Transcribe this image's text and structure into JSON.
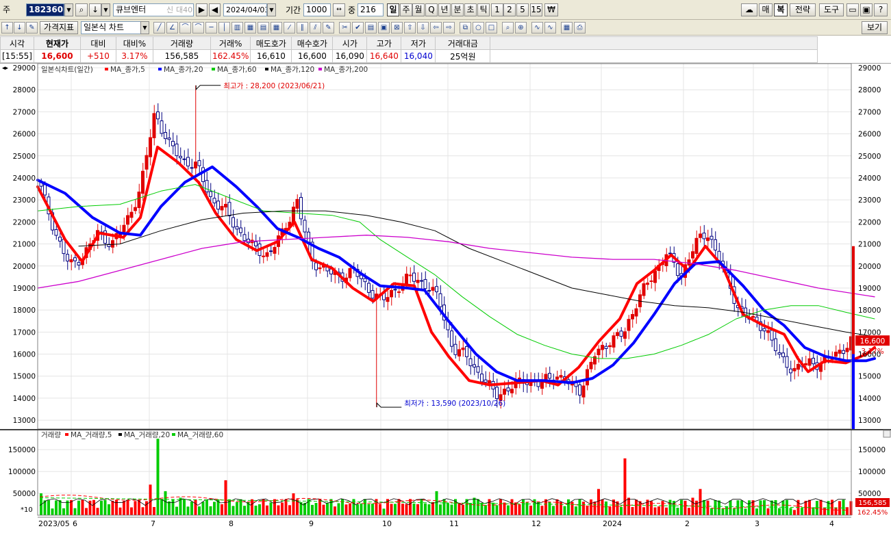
{
  "toolbar": {
    "code_label": "주",
    "code": "182360",
    "name": "큐브엔터",
    "badge1": "신",
    "badge2": "대40",
    "date": "2024/04/03",
    "period_label": "기간",
    "period": "1000",
    "count_label": "중",
    "count": "216",
    "periods": [
      "일",
      "주",
      "월",
      "Q",
      "년",
      "분",
      "초",
      "틱",
      "1",
      "2",
      "5",
      "15",
      "₩"
    ],
    "active_period": "일",
    "right_buttons": [
      "매",
      "복",
      "전략",
      "도구"
    ]
  },
  "toolbar2": {
    "menu1": "가격지표",
    "chart_type": "일본식 차트",
    "right_button": "보기"
  },
  "quote": {
    "headers": [
      "시각",
      "현재가",
      "대비",
      "대비%",
      "거래량",
      "거래%",
      "매도호가",
      "매수호가",
      "시가",
      "고가",
      "저가",
      "거래대금"
    ],
    "values": [
      "[15:55]",
      "16,600",
      "+510",
      "3.17%",
      "156,585",
      "162.45%",
      "16,610",
      "16,600",
      "16,090",
      "16,640",
      "16,040",
      "25억원"
    ]
  },
  "colors": {
    "up": "#e00000",
    "down": "#000080",
    "ma5": "#ff0000",
    "ma20": "#0000ff",
    "ma60": "#00cc00",
    "ma120": "#000000",
    "ma200": "#cc00cc"
  },
  "price_chart": {
    "legend_title": "일본식차트(일간)",
    "legend": [
      "MA_종가,5",
      "MA_종가,20",
      "MA_종가,60",
      "MA_종가,120",
      "MA_종가,200"
    ],
    "y_ticks": [
      "29000",
      "28000",
      "27000",
      "26000",
      "25000",
      "24000",
      "23000",
      "22000",
      "21000",
      "20000",
      "19000",
      "18000",
      "17000",
      "16000",
      "15000",
      "14000",
      "13000"
    ],
    "max_label": "최고가 : 28,200 (2023/06/21)",
    "min_label": "최저가 : 13,590 (2023/10/26)",
    "current_price": "16,600",
    "current_pct": "3.17%"
  },
  "volume_chart": {
    "legend_title": "거래량",
    "legend": [
      "MA_거래량,5",
      "MA_거래량,20",
      "MA_거래량,60"
    ],
    "y_ticks": [
      "150000",
      "100000",
      "50000"
    ],
    "unit_label": "*10",
    "current_volume": "156,585",
    "current_pct": "162.45%"
  },
  "x_axis": {
    "labels": [
      "2023/05",
      "6",
      "7",
      "8",
      "9",
      "10",
      "11",
      "12",
      "2024",
      "2",
      "3",
      "4"
    ]
  },
  "chart_data": {
    "type": "candlestick",
    "title": "일본식차트(일간)",
    "ylim": [
      12600,
      29000
    ],
    "x": [
      "2023/05",
      "6",
      "7",
      "8",
      "9",
      "10",
      "11",
      "12",
      "2024",
      "2",
      "3",
      "4"
    ],
    "close_anchor_points": [
      [
        "2023/05",
        23500
      ],
      [
        "2023/05",
        21500
      ],
      [
        "2023/05",
        20000
      ],
      [
        "6",
        20500
      ],
      [
        "6",
        21500
      ],
      [
        "6",
        21000
      ],
      [
        "6",
        22000
      ],
      [
        "6",
        23500
      ],
      [
        "6",
        27000
      ],
      [
        "6",
        25500
      ],
      [
        "7",
        24800
      ],
      [
        "7",
        24500
      ],
      [
        "7",
        23000
      ],
      [
        "7",
        22500
      ],
      [
        "7",
        21500
      ],
      [
        "7",
        20800
      ],
      [
        "8",
        20500
      ],
      [
        "8",
        21500
      ],
      [
        "8",
        23000
      ],
      [
        "8",
        20300
      ],
      [
        "8",
        19800
      ],
      [
        "8",
        19500
      ],
      [
        "9",
        19800
      ],
      [
        "9",
        19000
      ],
      [
        "9",
        18400
      ],
      [
        "9",
        19000
      ],
      [
        "9",
        19500
      ],
      [
        "10",
        19200
      ],
      [
        "10",
        18500
      ],
      [
        "10",
        16200
      ],
      [
        "10",
        15900
      ],
      [
        "10",
        14900
      ],
      [
        "10",
        14200
      ],
      [
        "11",
        14400
      ],
      [
        "11",
        14900
      ],
      [
        "11",
        14600
      ],
      [
        "11",
        15100
      ],
      [
        "11",
        14700
      ],
      [
        "12",
        14400
      ],
      [
        "12",
        16000
      ],
      [
        "12",
        16600
      ],
      [
        "12",
        16900
      ],
      [
        "12",
        18500
      ],
      [
        "2024",
        19500
      ],
      [
        "2024",
        20600
      ],
      [
        "2024",
        19500
      ],
      [
        "2024",
        21000
      ],
      [
        "2024",
        21500
      ],
      [
        "2",
        19800
      ],
      [
        "2",
        18200
      ],
      [
        "2",
        17500
      ],
      [
        "2",
        17200
      ],
      [
        "3",
        15800
      ],
      [
        "3",
        15300
      ],
      [
        "3",
        15600
      ],
      [
        "3",
        15600
      ],
      [
        "4",
        16000
      ],
      [
        "4",
        16600
      ]
    ],
    "series": [
      {
        "name": "MA_종가,5",
        "points": [
          [
            0,
            23600
          ],
          [
            40,
            21200
          ],
          [
            65,
            20200
          ],
          [
            90,
            21500
          ],
          [
            125,
            21300
          ],
          [
            150,
            22200
          ],
          [
            175,
            25400
          ],
          [
            205,
            24700
          ],
          [
            235,
            23800
          ],
          [
            260,
            22400
          ],
          [
            290,
            21200
          ],
          [
            320,
            20700
          ],
          [
            350,
            21100
          ],
          [
            375,
            22000
          ],
          [
            400,
            20300
          ],
          [
            430,
            19900
          ],
          [
            460,
            19000
          ],
          [
            490,
            18400
          ],
          [
            520,
            19200
          ],
          [
            550,
            19100
          ],
          [
            575,
            17000
          ],
          [
            600,
            15900
          ],
          [
            630,
            14800
          ],
          [
            660,
            14600
          ],
          [
            700,
            14700
          ],
          [
            735,
            14800
          ],
          [
            760,
            14600
          ],
          [
            790,
            15400
          ],
          [
            820,
            16600
          ],
          [
            850,
            17600
          ],
          [
            875,
            19200
          ],
          [
            900,
            19800
          ],
          [
            925,
            20500
          ],
          [
            950,
            19800
          ],
          [
            975,
            20900
          ],
          [
            1000,
            20000
          ],
          [
            1030,
            17800
          ],
          [
            1060,
            17300
          ],
          [
            1090,
            16900
          ],
          [
            1110,
            15800
          ],
          [
            1125,
            15200
          ],
          [
            1150,
            15700
          ],
          [
            1180,
            15600
          ],
          [
            1210,
            16000
          ],
          [
            1222,
            16300
          ]
        ]
      },
      {
        "name": "MA_종가,20",
        "points": [
          [
            0,
            23900
          ],
          [
            40,
            23300
          ],
          [
            80,
            22200
          ],
          [
            120,
            21500
          ],
          [
            150,
            21400
          ],
          [
            180,
            22700
          ],
          [
            215,
            23800
          ],
          [
            255,
            24500
          ],
          [
            290,
            23600
          ],
          [
            320,
            22700
          ],
          [
            350,
            21700
          ],
          [
            380,
            21300
          ],
          [
            410,
            20800
          ],
          [
            440,
            20400
          ],
          [
            470,
            19700
          ],
          [
            500,
            19100
          ],
          [
            540,
            19000
          ],
          [
            565,
            18900
          ],
          [
            600,
            17500
          ],
          [
            640,
            16000
          ],
          [
            670,
            15200
          ],
          [
            700,
            14800
          ],
          [
            740,
            14800
          ],
          [
            780,
            14700
          ],
          [
            810,
            14900
          ],
          [
            840,
            15500
          ],
          [
            870,
            16500
          ],
          [
            900,
            17800
          ],
          [
            930,
            19200
          ],
          [
            960,
            20100
          ],
          [
            995,
            20200
          ],
          [
            1030,
            19100
          ],
          [
            1060,
            18000
          ],
          [
            1090,
            17300
          ],
          [
            1120,
            16300
          ],
          [
            1150,
            15900
          ],
          [
            1180,
            15700
          ],
          [
            1210,
            15700
          ],
          [
            1222,
            15800
          ]
        ]
      },
      {
        "name": "MA_종가,60",
        "points": [
          [
            0,
            22500
          ],
          [
            60,
            22700
          ],
          [
            120,
            22800
          ],
          [
            180,
            23400
          ],
          [
            230,
            23700
          ],
          [
            280,
            23100
          ],
          [
            330,
            22500
          ],
          [
            380,
            22400
          ],
          [
            430,
            22300
          ],
          [
            470,
            22000
          ],
          [
            500,
            21200
          ],
          [
            540,
            20400
          ],
          [
            580,
            19600
          ],
          [
            620,
            18600
          ],
          [
            660,
            17700
          ],
          [
            700,
            16900
          ],
          [
            740,
            16400
          ],
          [
            780,
            16000
          ],
          [
            820,
            15800
          ],
          [
            860,
            15800
          ],
          [
            900,
            16000
          ],
          [
            940,
            16400
          ],
          [
            980,
            16900
          ],
          [
            1020,
            17600
          ],
          [
            1060,
            18000
          ],
          [
            1100,
            18200
          ],
          [
            1140,
            18200
          ],
          [
            1180,
            17900
          ],
          [
            1222,
            17600
          ]
        ]
      },
      {
        "name": "MA_종가,120",
        "points": [
          [
            60,
            20900
          ],
          [
            120,
            21000
          ],
          [
            180,
            21600
          ],
          [
            240,
            22100
          ],
          [
            300,
            22400
          ],
          [
            360,
            22500
          ],
          [
            420,
            22500
          ],
          [
            480,
            22300
          ],
          [
            530,
            22000
          ],
          [
            580,
            21600
          ],
          [
            630,
            20800
          ],
          [
            680,
            20200
          ],
          [
            730,
            19600
          ],
          [
            780,
            19000
          ],
          [
            830,
            18700
          ],
          [
            880,
            18400
          ],
          [
            930,
            18200
          ],
          [
            980,
            18100
          ],
          [
            1030,
            17900
          ],
          [
            1080,
            17600
          ],
          [
            1130,
            17300
          ],
          [
            1180,
            17000
          ],
          [
            1222,
            16800
          ]
        ]
      },
      {
        "name": "MA_종가,200",
        "points": [
          [
            0,
            19000
          ],
          [
            60,
            19300
          ],
          [
            120,
            19800
          ],
          [
            180,
            20300
          ],
          [
            240,
            20800
          ],
          [
            300,
            21100
          ],
          [
            360,
            21200
          ],
          [
            420,
            21300
          ],
          [
            480,
            21400
          ],
          [
            540,
            21300
          ],
          [
            600,
            21100
          ],
          [
            660,
            20800
          ],
          [
            720,
            20600
          ],
          [
            780,
            20400
          ],
          [
            840,
            20300
          ],
          [
            900,
            20300
          ],
          [
            960,
            20100
          ],
          [
            1020,
            19800
          ],
          [
            1080,
            19400
          ],
          [
            1140,
            19000
          ],
          [
            1222,
            18600
          ]
        ]
      }
    ],
    "volume_anchor_points": [
      [
        0,
        50000
      ],
      [
        60,
        35000
      ],
      [
        100,
        25000
      ],
      [
        160,
        70000
      ],
      [
        170,
        175000
      ],
      [
        180,
        55000
      ],
      [
        205,
        40000
      ],
      [
        265,
        25000
      ],
      [
        270,
        80000
      ],
      [
        320,
        25000
      ],
      [
        370,
        50000
      ],
      [
        380,
        30000
      ],
      [
        430,
        20000
      ],
      [
        500,
        15000
      ],
      [
        570,
        30000
      ],
      [
        575,
        55000
      ],
      [
        630,
        40000
      ],
      [
        700,
        25000
      ],
      [
        780,
        20000
      ],
      [
        815,
        60000
      ],
      [
        855,
        130000
      ],
      [
        860,
        40000
      ],
      [
        900,
        20000
      ],
      [
        950,
        40000
      ],
      [
        960,
        60000
      ],
      [
        1000,
        20000
      ],
      [
        1100,
        12000
      ],
      [
        1222,
        15600
      ]
    ],
    "volume_ylim": [
      0,
      180000
    ]
  }
}
